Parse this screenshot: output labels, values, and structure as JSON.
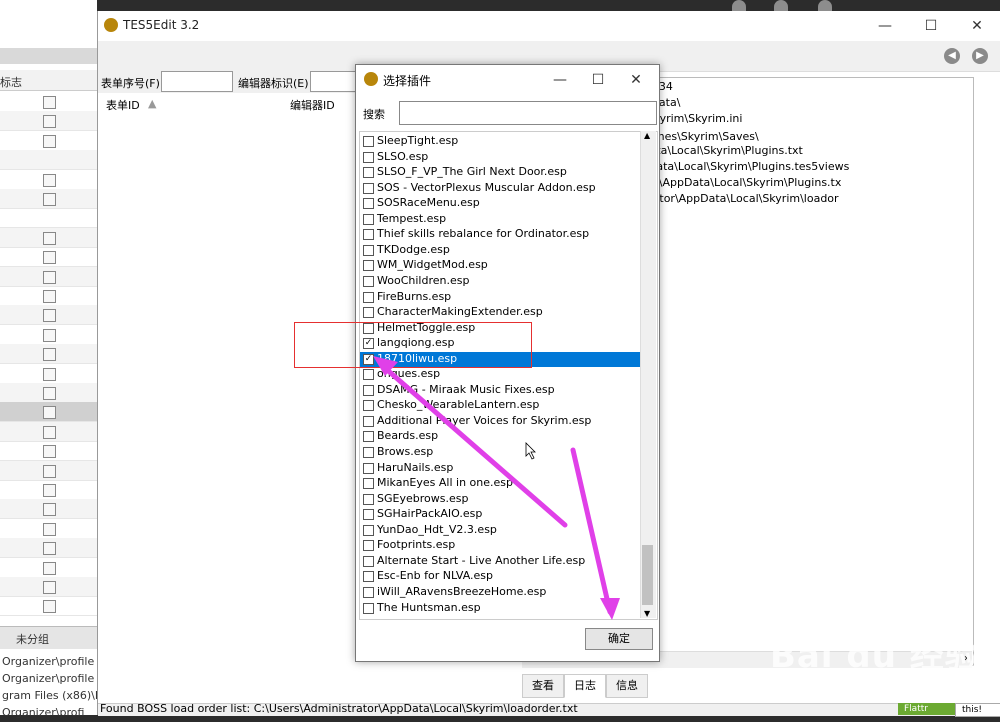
{
  "bg_app": {
    "column_header": "标志",
    "group_label": "未分组",
    "path_lines": [
      "Organizer\\profile",
      "Organizer\\profile",
      "gram Files (x86)\\M",
      "Organizer\\profi"
    ]
  },
  "main_window": {
    "title": "TES5Edit 3.2",
    "filter": {
      "form_id_label": "表单序号(F)",
      "editor_id_label": "编辑器标识(E)"
    },
    "columns": {
      "form_id": "表单ID",
      "editor_id": "编辑器ID"
    },
    "log_lines": [
      "ision 2019-01-08 15:03:34",
      "D:\\PROGRA~1\\Skyrim\\Data\\",
      "ocuments\\My Games\\Skyrim\\Skyrim.ini",
      "文档\\Documents\\My Games\\Skyrim\\Saves\\",
      "rs\\Administrator\\AppData\\Local\\Skyrim\\Plugins.txt",
      "ers\\Administrator\\AppData\\Local\\Skyrim\\Plugins.tes5views",
      ": C:\\Users\\Administrator\\AppData\\Local\\Skyrim\\Plugins.tx",
      "list: C:\\Users\\Administrator\\AppData\\Local\\Skyrim\\loador"
    ],
    "tabs": [
      "查看",
      "日志",
      "信息"
    ],
    "active_tab": "日志",
    "status": "Found BOSS load order list: C:\\Users\\Administrator\\AppData\\Local\\Skyrim\\loadorder.txt"
  },
  "dialog": {
    "title": "选择插件",
    "search_label": "搜索",
    "ok_label": "确定",
    "items": [
      {
        "name": "SleepTight.esp",
        "checked": false
      },
      {
        "name": "SLSO.esp",
        "checked": false
      },
      {
        "name": "SLSO_F_VP_The Girl Next Door.esp",
        "checked": false
      },
      {
        "name": "SOS - VectorPlexus Muscular Addon.esp",
        "checked": false
      },
      {
        "name": "SOSRaceMenu.esp",
        "checked": false
      },
      {
        "name": "Tempest.esp",
        "checked": false
      },
      {
        "name": "Thief skills rebalance for Ordinator.esp",
        "checked": false
      },
      {
        "name": "TKDodge.esp",
        "checked": false
      },
      {
        "name": "WM_WidgetMod.esp",
        "checked": false
      },
      {
        "name": "WooChildren.esp",
        "checked": false
      },
      {
        "name": "FireBurns.esp",
        "checked": false
      },
      {
        "name": "CharacterMakingExtender.esp",
        "checked": false
      },
      {
        "name": "HelmetToggle.esp",
        "checked": false
      },
      {
        "name": "langqiong.esp",
        "checked": true
      },
      {
        "name": "18710liwu.esp",
        "checked": true,
        "selected": true
      },
      {
        "name": "ongues.esp",
        "checked": false
      },
      {
        "name": "DSAMG - Miraak Music Fixes.esp",
        "checked": false
      },
      {
        "name": "Chesko_WearableLantern.esp",
        "checked": false
      },
      {
        "name": "Additional Player Voices for Skyrim.esp",
        "checked": false
      },
      {
        "name": "Beards.esp",
        "checked": false
      },
      {
        "name": "Brows.esp",
        "checked": false
      },
      {
        "name": "HaruNails.esp",
        "checked": false
      },
      {
        "name": "MikanEyes All in one.esp",
        "checked": false
      },
      {
        "name": "SGEyebrows.esp",
        "checked": false
      },
      {
        "name": "SGHairPackAIO.esp",
        "checked": false
      },
      {
        "name": "YunDao_Hdt_V2.3.esp",
        "checked": false
      },
      {
        "name": "Footprints.esp",
        "checked": false
      },
      {
        "name": "Alternate Start - Live Another Life.esp",
        "checked": false
      },
      {
        "name": "Esc-Enb for NLVA.esp",
        "checked": false
      },
      {
        "name": "iWill_ARavensBreezeHome.esp",
        "checked": false
      },
      {
        "name": "The Huntsman.esp",
        "checked": false
      }
    ]
  },
  "overlay": {
    "flattr": "Flattr",
    "this": "this!",
    "watermark": "Bai du 经验",
    "watermark_url": "jingyan.baidu.com",
    "annotation_color": "#e040e8",
    "highlight_color": "#e53030"
  }
}
